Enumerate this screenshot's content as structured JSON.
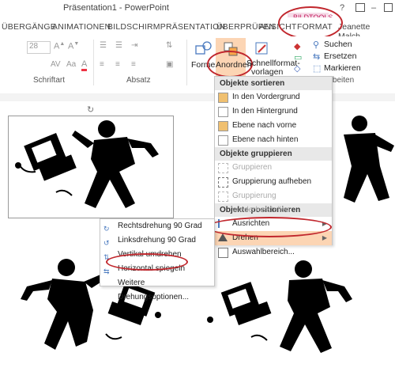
{
  "window": {
    "title": "Präsentation1 - PowerPoint"
  },
  "contextual": {
    "label": "BILDTOOLS",
    "format_tab": "FORMAT"
  },
  "user": {
    "name": "Jeanette Malch..."
  },
  "tabs": [
    "ÜBERGÄNGE",
    "ANIMATIONEN",
    "BILDSCHIRMPRÄSENTATION",
    "ÜBERPRÜFEN",
    "ANSICHT"
  ],
  "ribbon": {
    "font_size": "28",
    "groups": {
      "schriftart": "Schriftart",
      "absatz": "Absatz",
      "bearbeiten": "arbeiten"
    },
    "buttons": {
      "formen": "Formen",
      "anordnen": "Anordnen",
      "schnellformat": "Schnellformat-",
      "vorlagen": "vorlagen",
      "suchen": "Suchen",
      "ersetzen": "Ersetzen",
      "markieren": "Markieren"
    }
  },
  "arrange_menu": {
    "sections": [
      {
        "header": "Objekte sortieren",
        "items": [
          {
            "label": "In den Vordergrund",
            "disabled": false
          },
          {
            "label": "In den Hintergrund",
            "disabled": false
          },
          {
            "label": "Ebene nach vorne",
            "disabled": false
          },
          {
            "label": "Ebene nach hinten",
            "disabled": false
          }
        ]
      },
      {
        "header": "Objekte gruppieren",
        "items": [
          {
            "label": "Gruppieren",
            "disabled": true
          },
          {
            "label": "Gruppierung aufheben",
            "disabled": false
          },
          {
            "label": "Gruppierung wiederherstellen",
            "disabled": true
          }
        ]
      },
      {
        "header": "Objekte positionieren",
        "items": [
          {
            "label": "Ausrichten",
            "disabled": false
          },
          {
            "label": "Drehen",
            "disabled": false
          },
          {
            "label": "Auswahlbereich...",
            "disabled": false
          }
        ]
      }
    ]
  },
  "rotate_menu": {
    "items": [
      "Rechtsdrehung 90 Grad",
      "Linksdrehung 90 Grad",
      "Vertikal umdrehen",
      "Horizontal spiegeln",
      "Weitere Drehungsoptionen..."
    ]
  },
  "colors": {
    "accent": "#c1272d",
    "highlight": "#fcd5b4",
    "contextual": "#d44a8a"
  }
}
